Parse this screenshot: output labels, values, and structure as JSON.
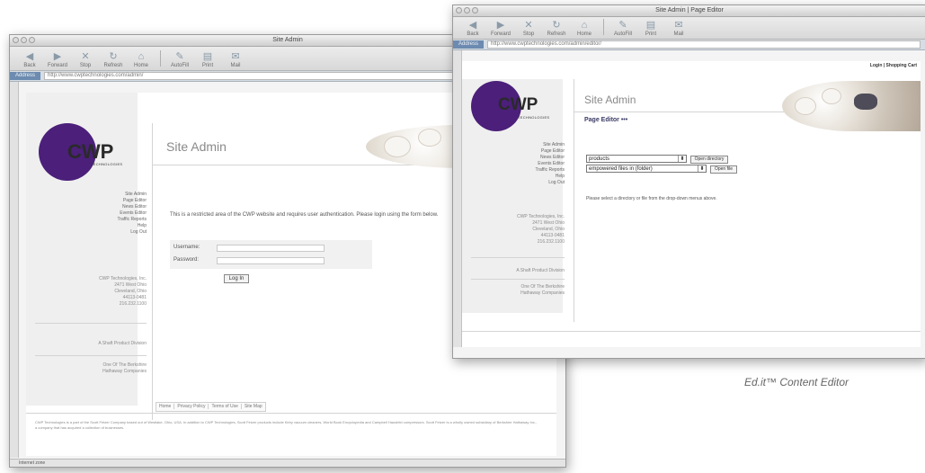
{
  "back_window": {
    "title": "Site Admin",
    "toolbar": [
      "Back",
      "Forward",
      "Stop",
      "Refresh",
      "Home",
      "AutoFill",
      "Print",
      "Mail"
    ],
    "address_label": "Address",
    "url": "http://www.cwptechnologies.com/admin/",
    "logo": {
      "text": "CWP",
      "sub": "TECHNOLOGIES"
    },
    "site_title": "Site Admin",
    "nav": [
      "Site Admin",
      "Page Editor",
      "News Editor",
      "Events Editor",
      "Traffic Reports",
      "Help",
      "Log Out"
    ],
    "address_block": [
      "CWP Technologies, Inc.",
      "2471 West Ohio",
      "Cleveland, Ohio",
      "44113-0481",
      "216.232.1100"
    ],
    "side_note_1": "A Shaft Product Division",
    "side_note_2": [
      "One Of The Berkshire",
      "Hathaway Companies"
    ],
    "intro": "This is a restricted area of the CWP website and requires user authentication. Please login using the form below.",
    "username_label": "Username:",
    "password_label": "Password:",
    "login_button": "Log In",
    "footer_links": [
      "Home",
      "Privacy Policy",
      "Terms of Use",
      "Site Map"
    ],
    "fine_print": "CWP Technologies is a part of the Scott Fetzer Company based out of Westlake, Ohio, USA. In addition to CWP Technologies, Scott Fetzer products include Kirby vacuum cleaners, World Book Encyclopedia and Campbell Hausfeld compressors. Scott Fetzer is a wholly owned subsidiary of Berkshire Hathaway Inc., a company that has acquired a collection of businesses.",
    "status": "Internet zone"
  },
  "front_window": {
    "title": "Site Admin | Page Editor",
    "toolbar": [
      "Back",
      "Forward",
      "Stop",
      "Refresh",
      "Home",
      "AutoFill",
      "Print",
      "Mail"
    ],
    "address_label": "Address",
    "url": "http://www.cwptechnologies.com/admin/editor/",
    "top_links": "Login | Shopping Cart",
    "logo": {
      "text": "CWP",
      "sub": "TECHNOLOGIES"
    },
    "site_title": "Site Admin",
    "section_title": "Page Editor",
    "nav": [
      "Site Admin",
      "Page Editor",
      "News Editor",
      "Events Editor",
      "Traffic Reports",
      "Help",
      "Log Out"
    ],
    "address_block": [
      "CWP Technologies, Inc.",
      "2471 West Ohio",
      "Cleveland, Ohio",
      "44113-0481",
      "216.232.1100"
    ],
    "side_note_1": "A Shaft Product Division",
    "side_note_2": [
      "One Of The Berkshire",
      "Hathaway Companies"
    ],
    "select_directory": "products",
    "open_directory_button": "Open directory",
    "select_file": "empowered files in (folder)",
    "open_file_button": "Open file",
    "instruction": "Please select a directory or file from the drop-down menus above."
  },
  "caption": "Ed.it™ Content Editor"
}
